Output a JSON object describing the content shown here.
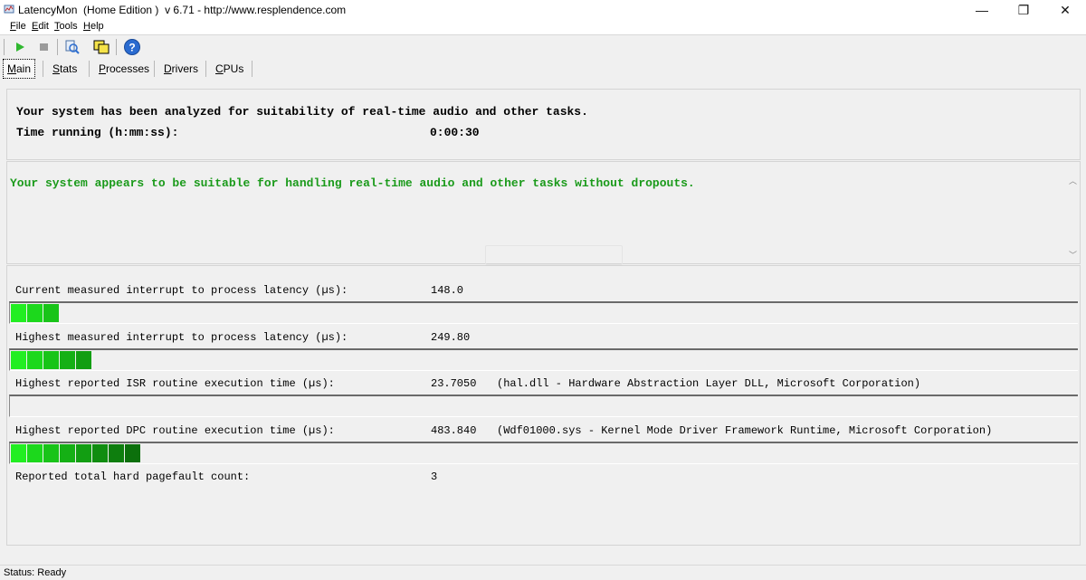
{
  "window": {
    "title": "LatencyMon  (Home Edition )  v 6.71 - http://www.resplendence.com",
    "minimize_glyph": "—",
    "maximize_glyph": "❐",
    "close_glyph": "✕"
  },
  "menu": [
    {
      "mnemonic": "F",
      "rest": "ile"
    },
    {
      "mnemonic": "E",
      "rest": "dit"
    },
    {
      "mnemonic": "T",
      "rest": "ools"
    },
    {
      "mnemonic": "H",
      "rest": "elp"
    }
  ],
  "toolbar": {
    "icons": [
      "start-icon",
      "stop-icon",
      "search-drivers-icon",
      "window-icon",
      "help-icon"
    ],
    "colors": {
      "play": "#2fb82f",
      "stop": "#9a9a9a",
      "help": "#2a6bd0"
    }
  },
  "tabs": [
    {
      "mnemonic": "M",
      "rest": "ain",
      "active": true
    },
    {
      "mnemonic": "S",
      "rest": "tats",
      "active": false
    },
    {
      "mnemonic": "P",
      "rest": "rocesses",
      "active": false
    },
    {
      "mnemonic": "D",
      "rest": "rivers",
      "active": false
    },
    {
      "mnemonic": "C",
      "rest": "PUs",
      "active": false
    }
  ],
  "summary": {
    "headline": "Your system has been analyzed for suitability of real-time audio and other tasks.",
    "time_label": "Time running (h:mm:ss):",
    "time_value": "0:00:30"
  },
  "verdict": {
    "text": "Your system appears to be suitable for handling real-time audio and other tasks without dropouts.",
    "color": "#1a9a1a"
  },
  "metrics": [
    {
      "label": "Current measured interrupt to process latency (µs):",
      "value": "148.0",
      "extra": "",
      "level_segments": 3
    },
    {
      "label": "Highest measured interrupt to process latency (µs):",
      "value": "249.80",
      "extra": "",
      "level_segments": 5
    },
    {
      "label": "Highest reported ISR routine execution time (µs):",
      "value": "23.7050",
      "extra": "(hal.dll - Hardware Abstraction Layer DLL, Microsoft Corporation)",
      "level_segments": 0
    },
    {
      "label": "Highest reported DPC routine execution time (µs):",
      "value": "483.840",
      "extra": "(Wdf01000.sys - Kernel Mode Driver Framework Runtime, Microsoft Corporation)",
      "level_segments": 8
    },
    {
      "label": "Reported total hard pagefault count:",
      "value": "3",
      "extra": "",
      "level_segments": null
    }
  ],
  "meter_colors": [
    "#22ee22",
    "#1cd81c",
    "#18c418",
    "#15b015",
    "#129e12",
    "#108d10",
    "#0e7e0e",
    "#0c700c"
  ],
  "status": {
    "text": "Status: Ready"
  }
}
